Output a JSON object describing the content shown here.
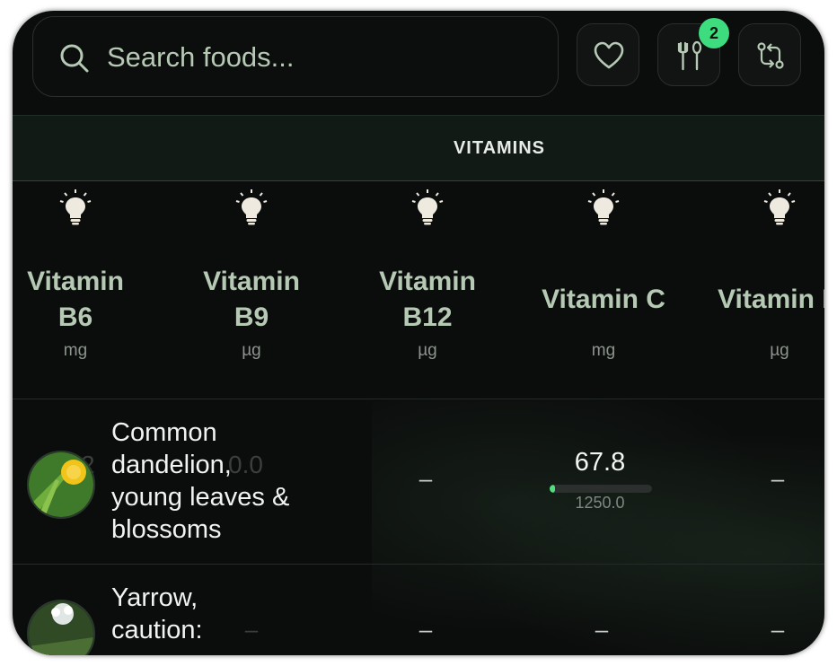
{
  "search": {
    "placeholder": "Search foods..."
  },
  "toolbar": {
    "favorites_icon": "heart-icon",
    "meal_icon": "fork-spoon-icon",
    "meal_badge": "2",
    "compare_icon": "swap-icon"
  },
  "category": {
    "label": "VITAMINS"
  },
  "columns": [
    {
      "name": "Vitamin B6",
      "line1": "Vitamin",
      "line2": "B6",
      "unit": "mg",
      "icon": "lightbulb-icon"
    },
    {
      "name": "Vitamin B9",
      "line1": "Vitamin",
      "line2": "B9",
      "unit": "µg",
      "icon": "lightbulb-icon"
    },
    {
      "name": "Vitamin B12",
      "line1": "Vitamin",
      "line2": "B12",
      "unit": "µg",
      "icon": "lightbulb-icon"
    },
    {
      "name": "Vitamin C",
      "line1": "Vitamin C",
      "line2": "",
      "unit": "mg",
      "icon": "lightbulb-icon"
    },
    {
      "name": "Vitamin D",
      "line1": "Vitamin D",
      "line2": "",
      "unit": "µg",
      "icon": "lightbulb-icon"
    }
  ],
  "rows": [
    {
      "name": "Common dandelion, young leaves & blossoms",
      "name_lines": [
        "Common",
        "dandelion,",
        "young leaves &",
        "blossoms"
      ],
      "ghost_value": "0.0",
      "ghost_prefix": "2",
      "b12": "–",
      "vitamin_c": {
        "value": "67.8",
        "reference": "1250.0",
        "fraction": 0.054
      },
      "vitamin_d": "–"
    },
    {
      "name": "Yarrow, caution: ...",
      "name_lines": [
        "Yarrow,",
        "caution:"
      ],
      "b9": "–",
      "b12": "–",
      "vitamin_c": "–",
      "vitamin_d": "–"
    }
  ],
  "colors": {
    "background": "#0b0d0c",
    "band": "#111a15",
    "accent_green": "#3ddc7e",
    "header_text": "#b6c9b4"
  }
}
